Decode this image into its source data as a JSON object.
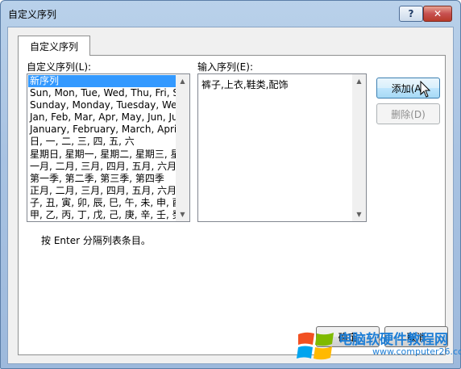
{
  "window": {
    "title": "自定义序列"
  },
  "titlebar": {
    "help_label": "?",
    "close_label": "✕"
  },
  "tab": {
    "label": "自定义序列"
  },
  "custom_lists": {
    "label": "自定义序列(L):",
    "items": [
      "新序列",
      "Sun, Mon, Tue, Wed, Thu, Fri, Sat",
      "Sunday, Monday, Tuesday, Wednesday",
      "Jan, Feb, Mar, Apr, May, Jun, Jul",
      "January, February, March, April",
      "日, 一, 二, 三, 四, 五, 六",
      "星期日, 星期一, 星期二, 星期三, 星",
      "一月, 二月, 三月, 四月, 五月, 六月,",
      "第一季, 第二季, 第三季, 第四季",
      "正月, 二月, 三月, 四月, 五月, 六月,",
      "子, 丑, 寅, 卯, 辰, 巳, 午, 未, 申, 酉",
      "甲, 乙, 丙, 丁, 戊, 己, 庚, 辛, 壬, 癸"
    ],
    "selected_index": 0
  },
  "entries": {
    "label": "输入序列(E):",
    "value": "裤子,上衣,鞋类,配饰"
  },
  "buttons": {
    "add": "添加(A)",
    "delete": "删除(D)",
    "ok": "确定",
    "cancel": "取消"
  },
  "hint": "按 Enter 分隔列表条目。",
  "watermark": {
    "title": "电脑软硬件教程网",
    "url": "www.computer26.com"
  },
  "colors": {
    "selection": "#3399ff",
    "close_button": "#c75050",
    "watermark": "#1f7fd6"
  }
}
